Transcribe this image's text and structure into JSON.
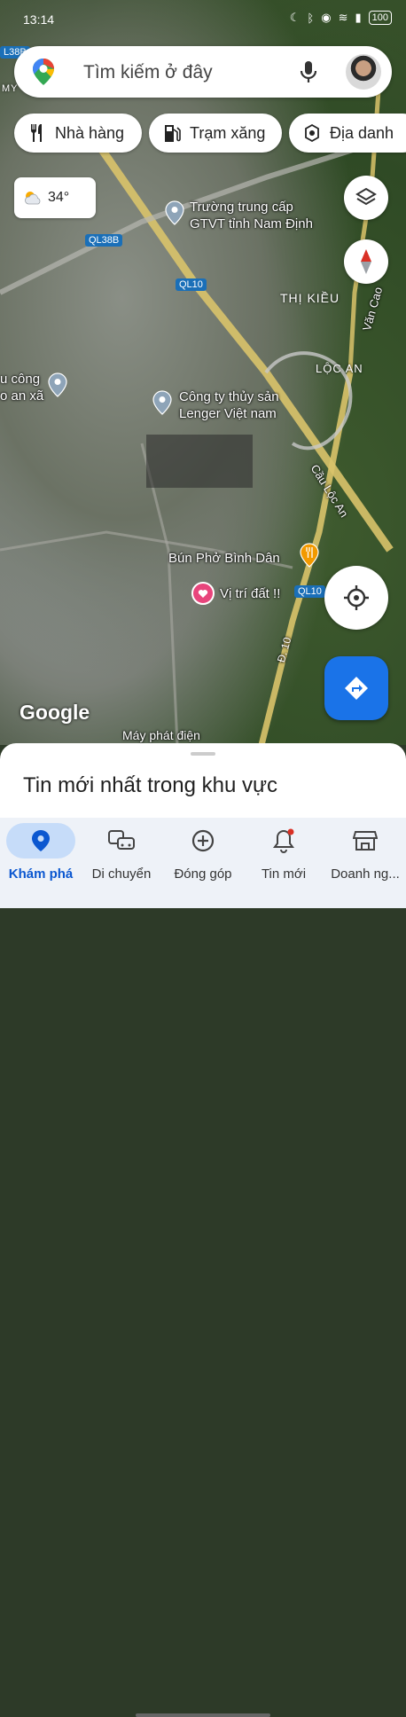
{
  "status": {
    "time": "13:14",
    "battery": "100"
  },
  "search": {
    "placeholder": "Tìm kiếm ở đây"
  },
  "chips": [
    {
      "label": "Nhà hàng",
      "icon": "restaurant-icon"
    },
    {
      "label": "Trạm xăng",
      "icon": "gas-station-icon"
    },
    {
      "label": "Địa danh",
      "icon": "landmark-icon"
    }
  ],
  "weather": {
    "temp": "34°",
    "icon": "partly-cloudy-icon"
  },
  "map": {
    "roads": [
      "QL38B",
      "QL38B",
      "QL10",
      "QL10",
      "Đ. 10",
      "Văn Cao",
      "Cầu Lộc An"
    ],
    "places": [
      {
        "name": "Trường trung cấp\nGTVT tỉnh Nam Định"
      },
      {
        "name": "Công ty thủy sản\nLenger Việt nam"
      },
      {
        "name": "Bún Phở Bình Dân"
      },
      {
        "name": "Vị trí đất !!"
      },
      {
        "name": "u công\no an xã"
      },
      {
        "name": "Máy phát điện"
      }
    ],
    "areas": [
      "THỊ KIỀU",
      "LỘC AN"
    ],
    "attribution": "Google",
    "misc_labels": [
      "MY",
      "L38B"
    ]
  },
  "sheet": {
    "title": "Tin mới nhất trong khu vực"
  },
  "bottom_nav": [
    {
      "label": "Khám phá",
      "icon": "explore-pin-icon",
      "active": true
    },
    {
      "label": "Di chuyển",
      "icon": "commute-icon",
      "active": false
    },
    {
      "label": "Đóng góp",
      "icon": "add-circle-icon",
      "active": false
    },
    {
      "label": "Tin mới",
      "icon": "bell-icon",
      "active": false
    },
    {
      "label": "Doanh ng...",
      "icon": "store-icon",
      "active": false
    }
  ],
  "colors": {
    "accent": "#1a73e8",
    "active_nav": "#0b57d0",
    "pin_pink": "#e8457c"
  }
}
